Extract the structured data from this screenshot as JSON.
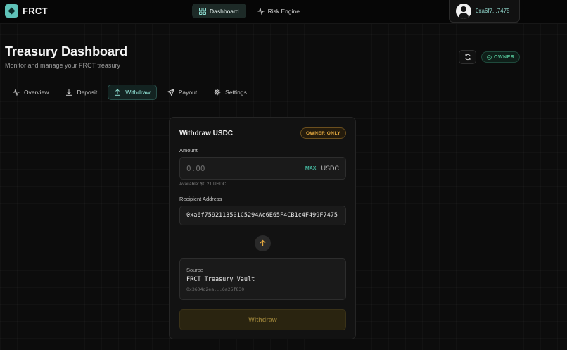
{
  "brand": {
    "name": "FRCT"
  },
  "nav": {
    "items": [
      {
        "label": "Dashboard",
        "icon": "grid-icon",
        "active": true
      },
      {
        "label": "Risk Engine",
        "icon": "activity-icon",
        "active": false
      }
    ]
  },
  "wallet": {
    "address": "0xa6f7...7475"
  },
  "header": {
    "title": "Treasury Dashboard",
    "subtitle": "Monitor and manage your FRCT treasury",
    "role_badge": "OWNER"
  },
  "tabs": [
    {
      "label": "Overview",
      "icon": "activity-icon"
    },
    {
      "label": "Deposit",
      "icon": "download-icon"
    },
    {
      "label": "Withdraw",
      "icon": "upload-icon",
      "active": true
    },
    {
      "label": "Payout",
      "icon": "send-icon"
    },
    {
      "label": "Settings",
      "icon": "gear-icon"
    }
  ],
  "withdraw": {
    "title": "Withdraw USDC",
    "badge": "OWNER ONLY",
    "amount_label": "Amount",
    "amount_placeholder": "0.00",
    "max_label": "MAX",
    "unit": "USDC",
    "available": "Available: $0.21 USDC",
    "recipient_label": "Recipient Address",
    "recipient_value": "0xa6f7592113501C5294Ac6E65F4CB1c4F499F7475",
    "source_label": "Source",
    "source_name": "FRCT Treasury Vault",
    "source_address": "0x3604d2ea...6a25f830",
    "submit_label": "Withdraw"
  },
  "colors": {
    "accent": "#5fc2b8",
    "owner_green": "#4fb98f",
    "owner_only_amber": "#e0a63e"
  }
}
